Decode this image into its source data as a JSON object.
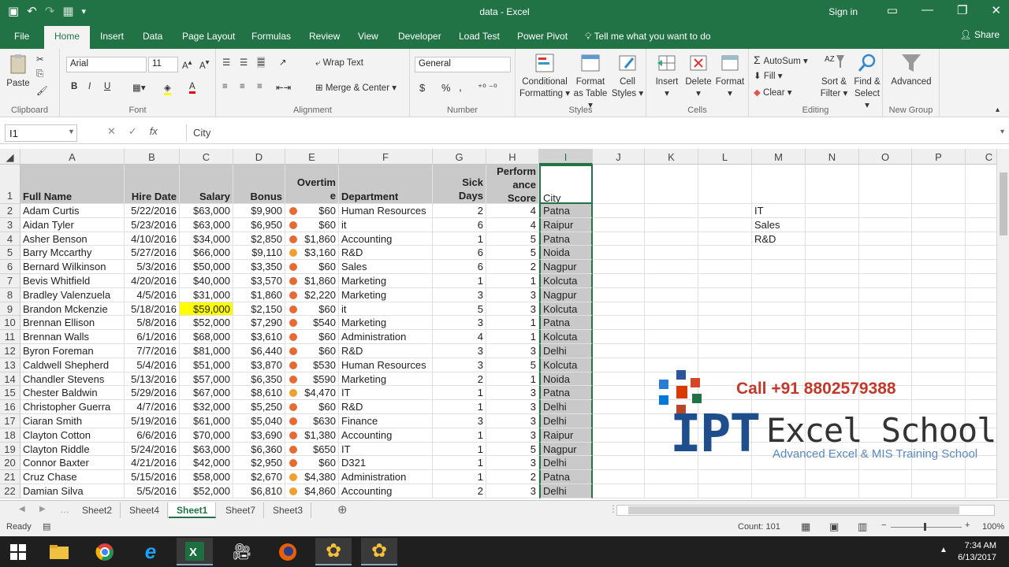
{
  "window": {
    "title": "data - Excel",
    "sign_in": "Sign in"
  },
  "ribbon_tabs": [
    "File",
    "Home",
    "Insert",
    "Data",
    "Page Layout",
    "Formulas",
    "Review",
    "View",
    "Developer",
    "Load Test",
    "Power Pivot"
  ],
  "tell_me": "Tell me what you want to do",
  "share": "Share",
  "ribbon": {
    "clipboard": {
      "label": "Clipboard",
      "paste": "Paste"
    },
    "font": {
      "label": "Font",
      "name": "Arial",
      "size": "11",
      "bold": "B",
      "italic": "I",
      "underline": "U"
    },
    "alignment": {
      "label": "Alignment",
      "wrap": "Wrap Text",
      "merge": "Merge & Center"
    },
    "number": {
      "label": "Number",
      "format": "General",
      "currency": "$",
      "percent": "%",
      "comma": ","
    },
    "styles": {
      "label": "Styles",
      "cond_fmt": "Conditional Formatting",
      "format_table": "Format as Table",
      "cell_styles": "Cell Styles"
    },
    "cells": {
      "label": "Cells",
      "insert": "Insert",
      "delete": "Delete",
      "format": "Format"
    },
    "editing": {
      "label": "Editing",
      "autosum": "AutoSum",
      "fill": "Fill",
      "clear": "Clear",
      "sort": "Sort & Filter",
      "find": "Find & Select"
    },
    "newgroup": {
      "label": "New Group",
      "advanced": "Advanced"
    }
  },
  "formula_bar": {
    "name_box": "I1",
    "value": "City",
    "fx": "fx"
  },
  "columns": [
    "A",
    "B",
    "C",
    "D",
    "E",
    "F",
    "G",
    "H",
    "I",
    "J",
    "K",
    "L",
    "M",
    "N",
    "O",
    "P",
    "C"
  ],
  "headers": {
    "A": "Full Name",
    "B": "Hire Date",
    "C": "Salary",
    "D": "Bonus",
    "E1": "Overtim",
    "E2": "e",
    "F": "Department",
    "G1": "Sick",
    "G2": "Days",
    "H1": "Perform",
    "H2": "ance",
    "H3": "Score",
    "I": "City"
  },
  "rows": [
    [
      "Adam Curtis",
      "5/22/2016",
      "$63,000",
      "$9,900",
      "down",
      "$60",
      "Human Resources",
      "2",
      "4",
      "Patna"
    ],
    [
      "Aidan Tyler",
      "5/23/2016",
      "$63,000",
      "$6,950",
      "down",
      "$60",
      "it",
      "6",
      "4",
      "Raipur"
    ],
    [
      "Asher Benson",
      "4/10/2016",
      "$34,000",
      "$2,850",
      "down",
      "$1,860",
      "Accounting",
      "1",
      "5",
      "Patna"
    ],
    [
      "Barry Mccarthy",
      "5/27/2016",
      "$66,000",
      "$9,110",
      "side",
      "$3,160",
      "R&D",
      "6",
      "5",
      "Noida"
    ],
    [
      "Bernard Wilkinson",
      "5/3/2016",
      "$50,000",
      "$3,350",
      "down",
      "$60",
      "Sales",
      "6",
      "2",
      "Nagpur"
    ],
    [
      "Bevis Whitfield",
      "4/20/2016",
      "$40,000",
      "$3,570",
      "down",
      "$1,860",
      "Marketing",
      "1",
      "1",
      "Kolcuta"
    ],
    [
      "Bradley Valenzuela",
      "4/5/2016",
      "$31,000",
      "$1,860",
      "down",
      "$2,220",
      "Marketing",
      "3",
      "3",
      "Nagpur"
    ],
    [
      "Brandon Mckenzie",
      "5/18/2016",
      "$59,000",
      "$2,150",
      "down",
      "$60",
      "it",
      "5",
      "3",
      "Kolcuta"
    ],
    [
      "Brennan Ellison",
      "5/8/2016",
      "$52,000",
      "$7,290",
      "down",
      "$540",
      "Marketing",
      "3",
      "1",
      "Patna"
    ],
    [
      "Brennan Walls",
      "6/1/2016",
      "$68,000",
      "$3,610",
      "down",
      "$60",
      "Administration",
      "4",
      "1",
      "Kolcuta"
    ],
    [
      "Byron Foreman",
      "7/7/2016",
      "$81,000",
      "$6,440",
      "down",
      "$60",
      "R&D",
      "3",
      "3",
      "Delhi"
    ],
    [
      "Caldwell Shepherd",
      "5/4/2016",
      "$51,000",
      "$3,870",
      "down",
      "$530",
      "Human Resources",
      "3",
      "5",
      "Kolcuta"
    ],
    [
      "Chandler Stevens",
      "5/13/2016",
      "$57,000",
      "$6,350",
      "down",
      "$590",
      "Marketing",
      "2",
      "1",
      "Noida"
    ],
    [
      "Chester Baldwin",
      "5/29/2016",
      "$67,000",
      "$8,610",
      "side",
      "$4,470",
      "IT",
      "1",
      "3",
      "Patna"
    ],
    [
      "Christopher Guerra",
      "4/7/2016",
      "$32,000",
      "$5,250",
      "down",
      "$60",
      "R&D",
      "1",
      "3",
      "Delhi"
    ],
    [
      "Ciaran Smith",
      "5/19/2016",
      "$61,000",
      "$5,040",
      "down",
      "$630",
      "Finance",
      "3",
      "3",
      "Delhi"
    ],
    [
      "Clayton Cotton",
      "6/6/2016",
      "$70,000",
      "$3,690",
      "down",
      "$1,380",
      "Accounting",
      "1",
      "3",
      "Raipur"
    ],
    [
      "Clayton Riddle",
      "5/24/2016",
      "$63,000",
      "$6,360",
      "down",
      "$650",
      "IT",
      "1",
      "5",
      "Nagpur"
    ],
    [
      "Connor Baxter",
      "4/21/2016",
      "$42,000",
      "$2,950",
      "down",
      "$60",
      "D321",
      "1",
      "3",
      "Delhi"
    ],
    [
      "Cruz Chase",
      "5/15/2016",
      "$58,000",
      "$2,670",
      "side",
      "$4,380",
      "Administration",
      "1",
      "2",
      "Patna"
    ],
    [
      "Damian Silva",
      "5/5/2016",
      "$52,000",
      "$6,810",
      "side",
      "$4,860",
      "Accounting",
      "2",
      "3",
      "Delhi"
    ]
  ],
  "side_list": [
    "IT",
    "Sales",
    "R&D"
  ],
  "highlight": {
    "row": 9,
    "col": "C",
    "color": "#ffff00"
  },
  "sheets": [
    "Sheet2",
    "Sheet4",
    "Sheet1",
    "Sheet7",
    "Sheet3"
  ],
  "active_sheet": "Sheet1",
  "status": {
    "ready": "Ready",
    "count": "Count: 101",
    "zoom": "100%"
  },
  "watermark": {
    "call": "Call +91 8802579388",
    "brand_a": "IPT",
    "brand_b": "Excel School",
    "tagline": "Advanced Excel & MIS Training School"
  },
  "clock": {
    "time": "7:34 AM",
    "date": "6/13/2017"
  },
  "colors": {
    "excel_green": "#217346",
    "header_gray": "#c9c9c9",
    "arrow_down": "#e86a33",
    "arrow_side": "#f0a030",
    "call_red": "#c0392b",
    "brand_blue": "#1f4e8c"
  }
}
